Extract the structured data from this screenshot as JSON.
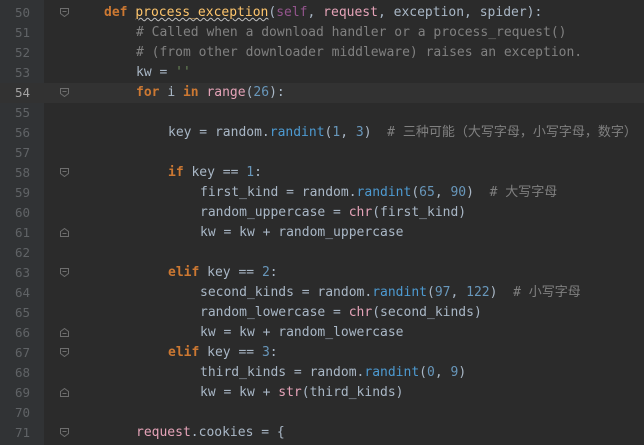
{
  "editor": {
    "lines": [
      {
        "num": "50",
        "fold": "open",
        "tokens": [
          [
            "kw",
            "def "
          ],
          [
            "fn squig",
            "process_exception"
          ],
          [
            "code",
            "("
          ],
          [
            "self",
            "self"
          ],
          [
            "code",
            ", "
          ],
          [
            "hl",
            "request"
          ],
          [
            "code",
            ", exception, spider):"
          ]
        ],
        "indent": 0
      },
      {
        "num": "51",
        "fold": "none",
        "tokens": [
          [
            "cm",
            "# Called when a download handler or a process_request()"
          ]
        ],
        "indent": 1
      },
      {
        "num": "52",
        "fold": "none",
        "tokens": [
          [
            "cm",
            "# (from other downloader middleware) raises an exception."
          ]
        ],
        "indent": 1
      },
      {
        "num": "53",
        "fold": "none",
        "tokens": [
          [
            "code",
            "kw = "
          ],
          [
            "str",
            "''"
          ]
        ],
        "indent": 1
      },
      {
        "num": "54",
        "fold": "open",
        "current": true,
        "tokens": [
          [
            "kw",
            "for "
          ],
          [
            "code",
            "i "
          ],
          [
            "kw",
            "in "
          ],
          [
            "chr",
            "range"
          ],
          [
            "code",
            "("
          ],
          [
            "num",
            "26"
          ],
          [
            "code",
            "):"
          ]
        ],
        "indent": 1
      },
      {
        "num": "55",
        "fold": "none",
        "tokens": [],
        "indent": 2
      },
      {
        "num": "56",
        "fold": "none",
        "tokens": [
          [
            "code",
            "key = random."
          ],
          [
            "call",
            "randint"
          ],
          [
            "code",
            "("
          ],
          [
            "num",
            "1"
          ],
          [
            "code",
            ", "
          ],
          [
            "num",
            "3"
          ],
          [
            "code",
            ")  "
          ],
          [
            "cm",
            "# 三种可能（大写字母，小写字母，数字）"
          ]
        ],
        "indent": 2
      },
      {
        "num": "57",
        "fold": "none",
        "tokens": [],
        "indent": 2
      },
      {
        "num": "58",
        "fold": "open",
        "tokens": [
          [
            "kw",
            "if "
          ],
          [
            "code",
            "key == "
          ],
          [
            "num",
            "1"
          ],
          [
            "code",
            ":"
          ]
        ],
        "indent": 2
      },
      {
        "num": "59",
        "fold": "none",
        "tokens": [
          [
            "code",
            "first_kind = random."
          ],
          [
            "call",
            "randint"
          ],
          [
            "code",
            "("
          ],
          [
            "num",
            "65"
          ],
          [
            "code",
            ", "
          ],
          [
            "num",
            "90"
          ],
          [
            "code",
            ")  "
          ],
          [
            "cm",
            "# 大写字母"
          ]
        ],
        "indent": 3
      },
      {
        "num": "60",
        "fold": "none",
        "tokens": [
          [
            "code",
            "random_uppercase = "
          ],
          [
            "chr",
            "chr"
          ],
          [
            "code",
            "(first_kind)"
          ]
        ],
        "indent": 3
      },
      {
        "num": "61",
        "fold": "close",
        "tokens": [
          [
            "code",
            "kw = kw + random_uppercase"
          ]
        ],
        "indent": 3
      },
      {
        "num": "62",
        "fold": "none",
        "tokens": [],
        "indent": 2
      },
      {
        "num": "63",
        "fold": "open",
        "tokens": [
          [
            "kw",
            "elif "
          ],
          [
            "code",
            "key == "
          ],
          [
            "num",
            "2"
          ],
          [
            "code",
            ":"
          ]
        ],
        "indent": 2
      },
      {
        "num": "64",
        "fold": "none",
        "tokens": [
          [
            "code",
            "second_kinds = random."
          ],
          [
            "call",
            "randint"
          ],
          [
            "code",
            "("
          ],
          [
            "num",
            "97"
          ],
          [
            "code",
            ", "
          ],
          [
            "num",
            "122"
          ],
          [
            "code",
            ")  "
          ],
          [
            "cm",
            "# 小写字母"
          ]
        ],
        "indent": 3
      },
      {
        "num": "65",
        "fold": "none",
        "tokens": [
          [
            "code",
            "random_lowercase = "
          ],
          [
            "chr",
            "chr"
          ],
          [
            "code",
            "(second_kinds)"
          ]
        ],
        "indent": 3
      },
      {
        "num": "66",
        "fold": "close",
        "tokens": [
          [
            "code",
            "kw = kw + random_lowercase"
          ]
        ],
        "indent": 3
      },
      {
        "num": "67",
        "fold": "open",
        "tokens": [
          [
            "kw",
            "elif "
          ],
          [
            "code",
            "key == "
          ],
          [
            "num",
            "3"
          ],
          [
            "code",
            ":"
          ]
        ],
        "indent": 2
      },
      {
        "num": "68",
        "fold": "none",
        "tokens": [
          [
            "code",
            "third_kinds = random."
          ],
          [
            "call",
            "randint"
          ],
          [
            "code",
            "("
          ],
          [
            "num",
            "0"
          ],
          [
            "code",
            ", "
          ],
          [
            "num",
            "9"
          ],
          [
            "code",
            ")"
          ]
        ],
        "indent": 3
      },
      {
        "num": "69",
        "fold": "close",
        "tokens": [
          [
            "code",
            "kw = kw + "
          ],
          [
            "chr",
            "str"
          ],
          [
            "code",
            "(third_kinds)"
          ]
        ],
        "indent": 3
      },
      {
        "num": "70",
        "fold": "none",
        "tokens": [],
        "indent": 1
      },
      {
        "num": "71",
        "fold": "open",
        "tokens": [
          [
            "hl",
            "request"
          ],
          [
            "code",
            ".cookies = {"
          ]
        ],
        "indent": 1
      }
    ]
  },
  "colors": {
    "background": "#2b2b2b",
    "gutter": "#313335",
    "current_line": "#323232",
    "keyword": "#cc7832",
    "function": "#ffc66d",
    "comment": "#808080",
    "number": "#6897bb",
    "string": "#6a8759"
  }
}
